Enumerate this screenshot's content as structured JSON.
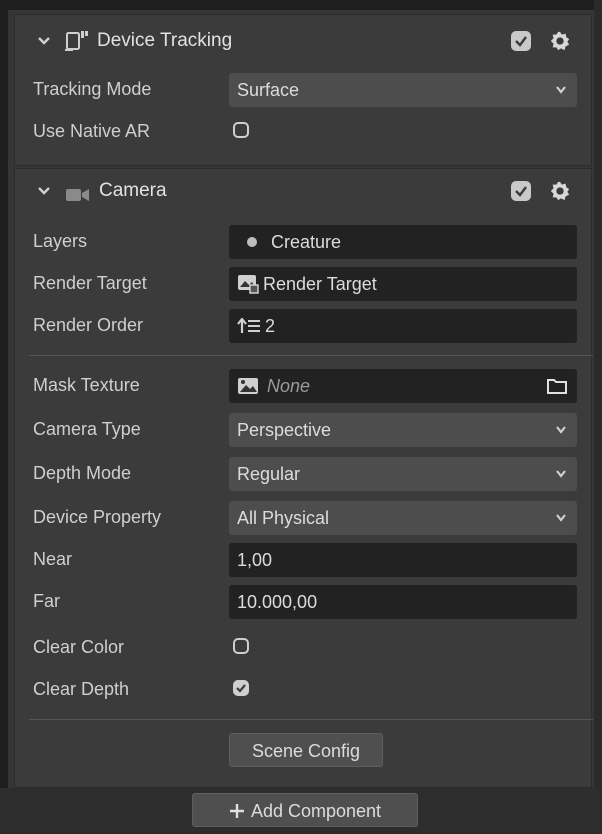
{
  "device_tracking": {
    "title": "Device Tracking",
    "enabled": true,
    "tracking_mode_label": "Tracking Mode",
    "tracking_mode_value": "Surface",
    "use_native_ar_label": "Use Native AR",
    "use_native_ar": false
  },
  "camera": {
    "title": "Camera",
    "enabled": true,
    "layers_label": "Layers",
    "layers_value": "Creature",
    "render_target_label": "Render Target",
    "render_target_value": "Render Target",
    "render_order_label": "Render Order",
    "render_order_value": "2",
    "mask_texture_label": "Mask Texture",
    "mask_texture_value": "None",
    "camera_type_label": "Camera Type",
    "camera_type_value": "Perspective",
    "depth_mode_label": "Depth Mode",
    "depth_mode_value": "Regular",
    "device_property_label": "Device Property",
    "device_property_value": "All Physical",
    "near_label": "Near",
    "near_value": "1,00",
    "far_label": "Far",
    "far_value": "10.000,00",
    "clear_color_label": "Clear Color",
    "clear_color": false,
    "clear_depth_label": "Clear Depth",
    "clear_depth": true,
    "scene_config_label": "Scene Config"
  },
  "footer": {
    "add_component_label": "Add Component"
  },
  "colors": {
    "panel_bg": "#3b3b3b",
    "dropdown_bg": "#4d4d4d",
    "input_bg": "#222222",
    "text": "#d6d6d6"
  }
}
